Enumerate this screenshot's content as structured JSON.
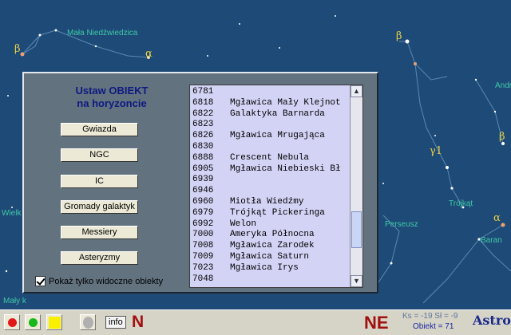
{
  "sky": {
    "labels": [
      {
        "id": "mala-niedzwiedzica",
        "text": "Mała Niedźwiedzica"
      },
      {
        "id": "andromeda",
        "text": "Andr"
      },
      {
        "id": "perseusz",
        "text": "Perseusz"
      },
      {
        "id": "trojkat",
        "text": "Trójkąt"
      },
      {
        "id": "baran",
        "text": "Baran"
      },
      {
        "id": "wieli",
        "text": "Wielk"
      },
      {
        "id": "maly",
        "text": "Mały k"
      }
    ],
    "greek": [
      "β",
      "α",
      "β",
      "γ1",
      "β",
      "α"
    ]
  },
  "dialog": {
    "title_line1": "Ustaw  OBIEKT",
    "title_line2": "na horyzoncie",
    "buttons": [
      "Gwiazda",
      "NGC",
      "IC",
      "Gromady galaktyk",
      "Messiery",
      "Asteryzmy"
    ],
    "checkbox_label": "Pokaż tylko widoczne obiekty",
    "checkbox_checked": true,
    "list_rows": [
      {
        "num": "6781",
        "name": ""
      },
      {
        "num": "6818",
        "name": "Mgławica Mały Klejnot"
      },
      {
        "num": "6822",
        "name": "Galaktyka Barnarda"
      },
      {
        "num": "6823",
        "name": ""
      },
      {
        "num": "6826",
        "name": "Mgławica Mrugająca"
      },
      {
        "num": "6830",
        "name": ""
      },
      {
        "num": "6888",
        "name": "Crescent Nebula"
      },
      {
        "num": "6905",
        "name": "Mgławica Niebieski Bł"
      },
      {
        "num": "6939",
        "name": ""
      },
      {
        "num": "6946",
        "name": ""
      },
      {
        "num": "6960",
        "name": "Miotła Wiedźmy"
      },
      {
        "num": "6979",
        "name": "Trójkąt Pickeringa"
      },
      {
        "num": "6992",
        "name": "Welon"
      },
      {
        "num": "7000",
        "name": "Ameryka Północna"
      },
      {
        "num": "7008",
        "name": "Mgławica Zarodek"
      },
      {
        "num": "7009",
        "name": "Mgławica Saturn"
      },
      {
        "num": "7023",
        "name": "Mgławica Irys"
      },
      {
        "num": "7048",
        "name": ""
      }
    ]
  },
  "toolbar": {
    "info_label": "info",
    "direction_left": "N",
    "direction_right": "NE",
    "coords": "Ks = -19   Sł = -9",
    "object_count": "Obiekt = 71",
    "app_name": "Astro",
    "colors": {
      "red": "#e01818",
      "green": "#18b818",
      "yellow": "#f8f000"
    }
  }
}
